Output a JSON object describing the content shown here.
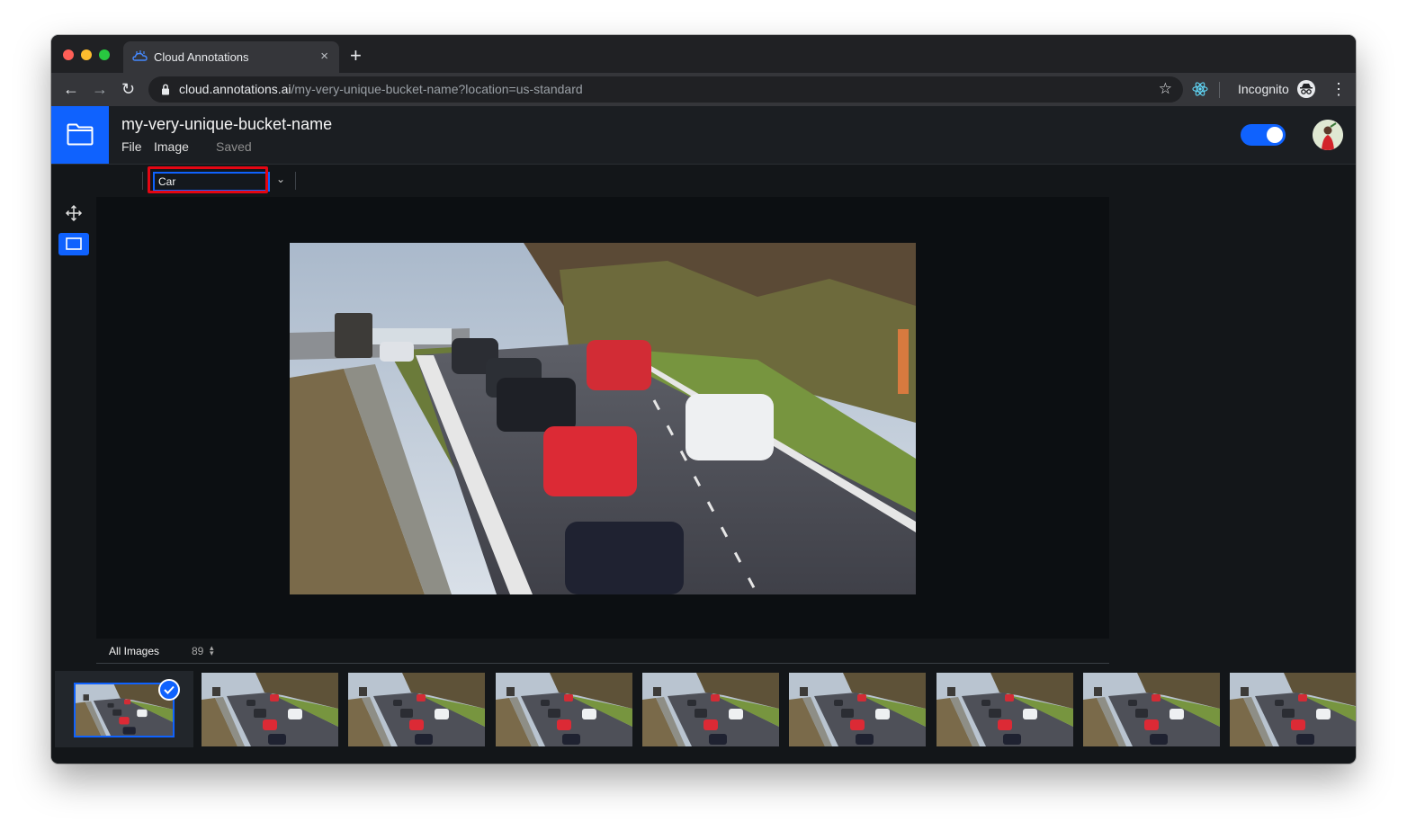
{
  "browser": {
    "tab_title": "Cloud Annotations",
    "tab_close": "×",
    "new_tab": "+",
    "back": "←",
    "forward": "→",
    "reload": "↻",
    "url_host": "cloud.annotations.ai",
    "url_path": "/my-very-unique-bucket-name?location=us-standard",
    "bookmark_star": "☆",
    "incognito_label": "Incognito",
    "menu": "⋮"
  },
  "app": {
    "bucket_name": "my-very-unique-bucket-name",
    "menu_file": "File",
    "menu_image": "Image",
    "status": "Saved",
    "toggle_on": true
  },
  "labeling": {
    "current_label": "Car",
    "dropdown_caret": "⌄"
  },
  "gallery": {
    "filter": "All Images",
    "count": "89",
    "sort_icon": "▴▾",
    "thumbnails": 9,
    "selected_index": 0
  },
  "colors": {
    "accent": "#0f62fe",
    "highlight": "#e40613",
    "background": "#131619"
  }
}
